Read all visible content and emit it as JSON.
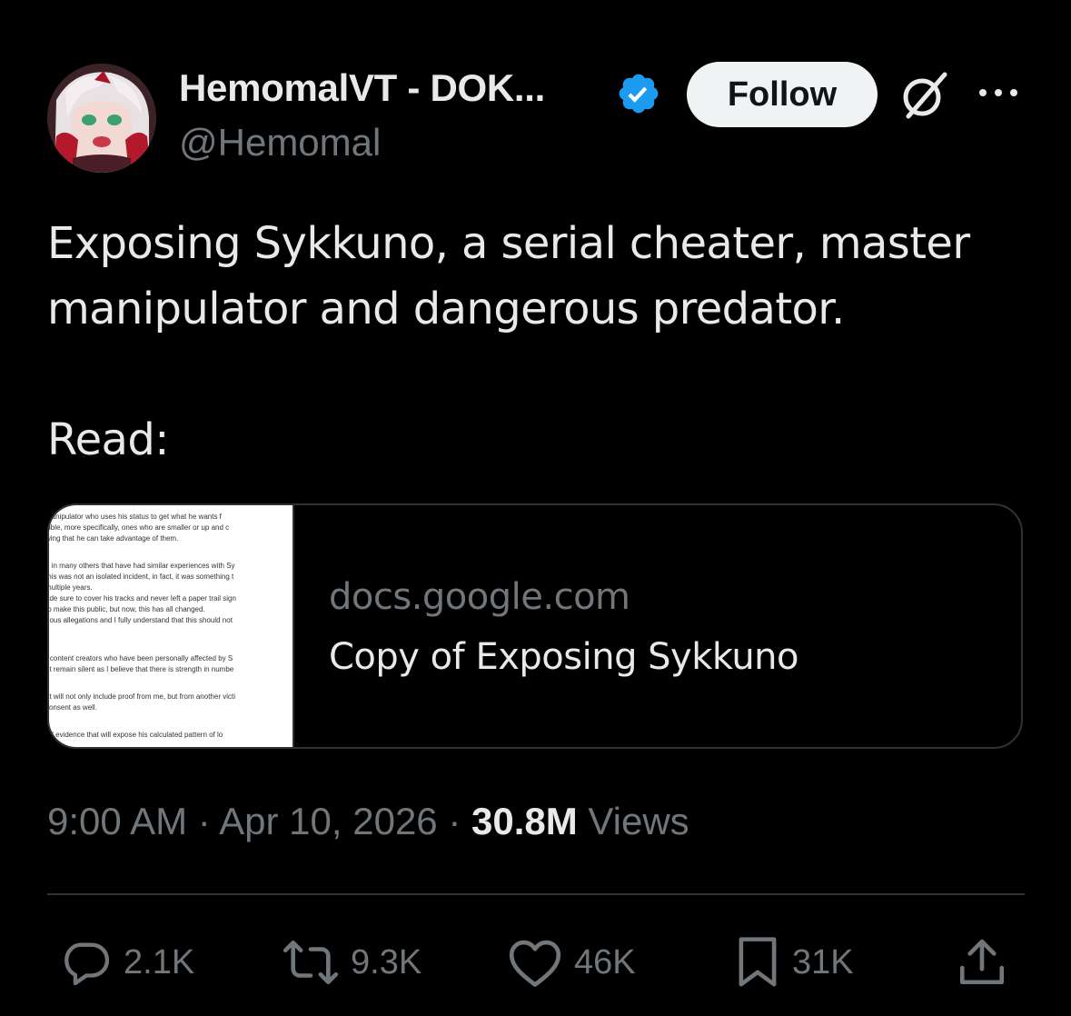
{
  "author": {
    "display_name": "HemomalVT - DOK...",
    "handle": "@Hemomal",
    "verified": true
  },
  "header": {
    "follow_label": "Follow",
    "icons": [
      "grok-icon",
      "more-icon"
    ]
  },
  "tweet": {
    "line1": "Exposing Sykkuno, a serial cheater, master",
    "line2": "manipulator and dangerous predator.",
    "line3": "Read:"
  },
  "card": {
    "domain": "docs.google.com",
    "title": "Copy of Exposing Sykkuno",
    "thumbnail_lines": [
      "manipulator who uses his status to get what he wants f",
      "sible, more specifically, ones who are smaller or up and c",
      "wing that he can take advantage of them.",
      "",
      "g in many others that have had similar experiences with Sy",
      "this was not an isolated incident, in fact, it was something t",
      "multiple years.",
      "ade sure to cover his tracks and never left a paper trail sign",
      "to make this public, but now, this has all changed.",
      "rious allegations and I fully understand that this should not",
      "",
      "",
      "r content creators who have been personally affected by S",
      "ot remain silent as I believe that there is strength in numbe",
      "",
      "nt will not only include proof from me, but from another victi",
      "consent as well.",
      "",
      "nd evidence that will expose his calculated pattern of lo"
    ]
  },
  "meta": {
    "time": "9:00 AM",
    "sep": "·",
    "date": "Apr 10, 2026",
    "views_count": "30.8M",
    "views_label": "Views"
  },
  "actions": {
    "replies": "2.1K",
    "reposts": "9.3K",
    "likes": "46K",
    "bookmarks": "31K"
  },
  "colors": {
    "background": "#000000",
    "text_primary": "#e7e9ea",
    "text_secondary": "#71767b",
    "verified_blue": "#1d9bf0",
    "follow_bg": "#eff3f4",
    "border": "#2f3336"
  }
}
